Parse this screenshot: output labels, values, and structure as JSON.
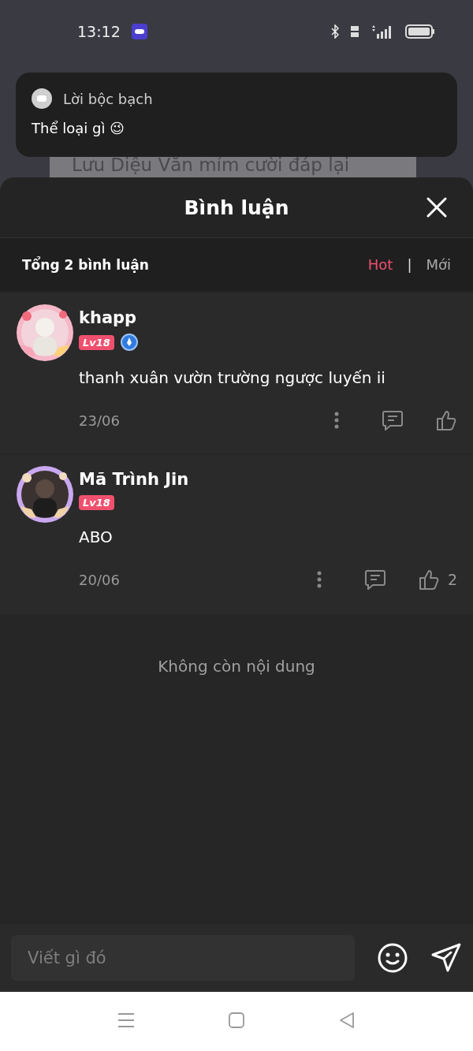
{
  "status_bar": {
    "time": "13:12"
  },
  "background": {
    "caption": "Lưu Diệu Văn mỉm cười đáp lại"
  },
  "notification": {
    "app": "Lời bộc bạch",
    "message": "Thể loại gì 😉"
  },
  "sheet": {
    "title": "Bình luận",
    "total": "Tổng 2 bình luận",
    "sort_tabs": [
      {
        "label": "Hot",
        "selected": true
      },
      {
        "label": "Mới",
        "selected": false
      }
    ],
    "separator": "|"
  },
  "comments": [
    {
      "user": "khapp",
      "level": "Lv18",
      "verified": true,
      "text": "thanh xuân vườn trường ngược luyến ii",
      "date": "23/06"
    },
    {
      "user": "Mã Trình Jin",
      "level": "Lv18",
      "verified": false,
      "text": "ABO",
      "date": "20/06",
      "likes": "2"
    }
  ],
  "end_note": "Không còn nội dung",
  "composer": {
    "placeholder": "Viết gì đó"
  }
}
